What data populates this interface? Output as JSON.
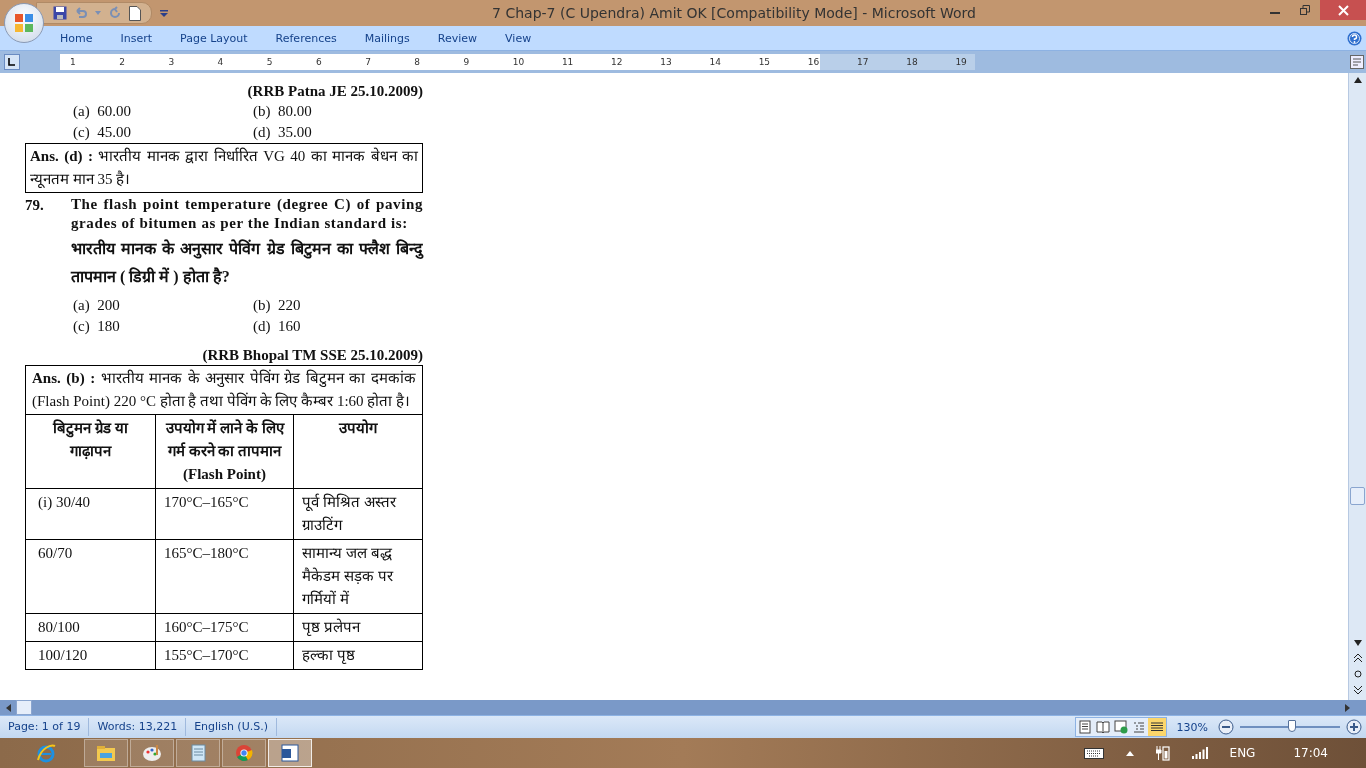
{
  "window": {
    "title": "7 Chap-7 (C Upendra) Amit OK [Compatibility Mode] - Microsoft Word"
  },
  "ribbon": {
    "tabs": [
      {
        "label": "Home"
      },
      {
        "label": "Insert"
      },
      {
        "label": "Page Layout"
      },
      {
        "label": "References"
      },
      {
        "label": "Mailings"
      },
      {
        "label": "Review"
      },
      {
        "label": "View"
      }
    ]
  },
  "ruler": {
    "numbers": [
      "1",
      "2",
      "3",
      "4",
      "5",
      "6",
      "7",
      "8",
      "9",
      "10",
      "11",
      "12",
      "13",
      "14",
      "15",
      "16",
      "17",
      "18",
      "19"
    ]
  },
  "document": {
    "source_1": "(RRB Patna JE 25.10.2009)",
    "options_1": [
      {
        "letter": "(a)",
        "value": "60.00"
      },
      {
        "letter": "(b)",
        "value": "80.00"
      },
      {
        "letter": "(c)",
        "value": "45.00"
      },
      {
        "letter": "(d)",
        "value": "35.00"
      }
    ],
    "answer_1": {
      "label": "Ans. (d) :",
      "text": "भारतीय मानक द्वारा निर्धारित VG 40 का मानक बेधन का न्यूनतम मान 35 है।"
    },
    "question": {
      "number": "79.",
      "text_en": "The flash point temperature (degree C) of paving grades of bitumen as per the Indian standard is:",
      "text_hi": "भारतीय मानक के अनुसार पेविंग ग्रेड बिटुमन का फ्लैश बिन्दु तापमान ( डिग्री में ) होता है?"
    },
    "options_2": [
      {
        "letter": "(a)",
        "value": "200"
      },
      {
        "letter": "(b)",
        "value": "220"
      },
      {
        "letter": "(c)",
        "value": "180"
      },
      {
        "letter": "(d)",
        "value": "160"
      }
    ],
    "source_2": "(RRB Bhopal TM SSE 25.10.2009)",
    "answer_2": {
      "label": "Ans. (b) :",
      "text": "भारतीय मानक के अनुसार पेविंग ग्रेड बिटुमन का दमकांक (Flash Point) 220 °C होता है तथा पेविंग के लिए कैम्बर 1:60 होता है।"
    },
    "table": {
      "columns": [
        "बिटुमन ग्रेड या गाढ़ापन",
        "उपयोग में लाने के लिए गर्म करने का तापमान (Flash Point)",
        "उपयोग"
      ],
      "rows": [
        [
          "(i) 30/40",
          "170°C–165°C",
          "पूर्व मिश्रित अस्तर ग्राउटिंग"
        ],
        [
          "60/70",
          "165°C–180°C",
          "सामान्य जल बद्ध मैकेडम सड़क पर गर्मियों में"
        ],
        [
          "80/100",
          "160°C–175°C",
          "पृष्ठ प्रलेपन"
        ],
        [
          "100/120",
          "155°C–170°C",
          "हल्का पृष्ठ"
        ]
      ]
    }
  },
  "status_bar": {
    "page": "Page: 1 of 19",
    "words": "Words: 13,221",
    "language": "English (U.S.)",
    "views": [
      {
        "kind": "print",
        "selected": false
      },
      {
        "kind": "reading",
        "selected": false
      },
      {
        "kind": "web",
        "selected": false
      },
      {
        "kind": "outline",
        "selected": false
      },
      {
        "kind": "draft",
        "selected": true
      }
    ],
    "zoom": "130%",
    "zoom_level": {
      "level": 0.52
    }
  },
  "taskbar": {
    "apps": [
      {
        "kind": "ie",
        "selected": false
      },
      {
        "kind": "explorer",
        "selected": false
      },
      {
        "kind": "paint",
        "selected": false
      },
      {
        "kind": "notepad",
        "selected": false
      },
      {
        "kind": "chrome",
        "selected": false
      },
      {
        "kind": "word",
        "selected": true
      }
    ],
    "language": "ENG",
    "time": "17:04"
  }
}
